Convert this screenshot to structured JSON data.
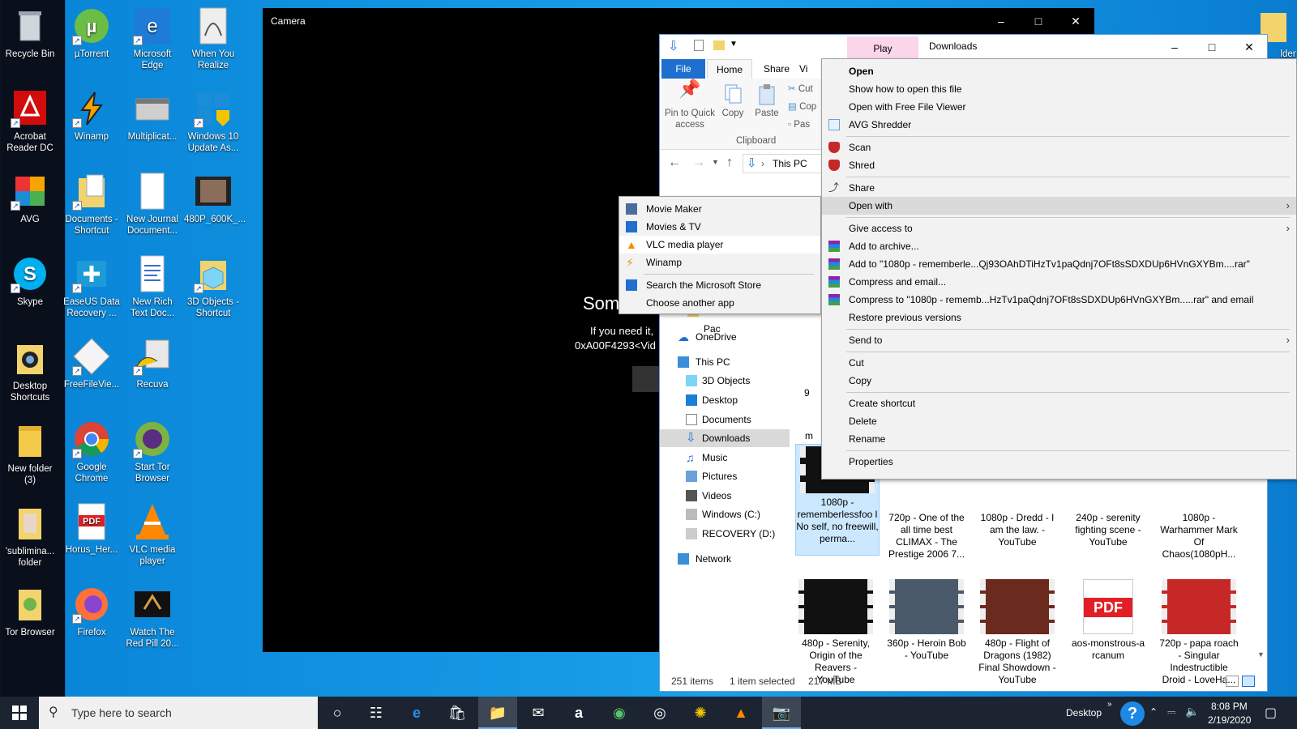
{
  "desktop": {
    "col1": [
      "Recycle Bin",
      "Acrobat Reader DC",
      "AVG",
      "Skype",
      "Desktop Shortcuts",
      "New folder (3)",
      "'sublimina... folder",
      "Tor Browser"
    ],
    "col2": [
      "µTorrent",
      "Winamp",
      "Documents - Shortcut",
      "EaseUS Data Recovery ...",
      "FreeFileVie...",
      "Google Chrome",
      "Horus_Her...",
      "Firefox"
    ],
    "col3": [
      "Microsoft Edge",
      "Multiplicat...",
      "New Journal Document...",
      "New Rich Text Doc...",
      "Recuva",
      "Start Tor Browser",
      "VLC media player",
      "Watch The Red Pill 20..."
    ],
    "col4": [
      "When You Realize",
      "Windows 10 Update As...",
      "480P_600K_...",
      "3D Objects - Shortcut"
    ],
    "right_edge": "lder"
  },
  "camera": {
    "title": "Camera",
    "message_heading": "Som",
    "message_line1": "If you need it,",
    "message_line2": "0xA00F4293<Vid"
  },
  "explorer": {
    "context_tab": "Play",
    "window_title": "Downloads",
    "tabs": [
      "File",
      "Home",
      "Share",
      "Vi"
    ],
    "clipboard": {
      "pin": "Pin to Quick access",
      "copy": "Copy",
      "paste": "Paste",
      "cut": "Cut",
      "copy_path": "Cop",
      "paste_shortcut": "Pas",
      "group_label": "Clipboard"
    },
    "address": "This PC",
    "nav": [
      "Kimber Lee - VR Pac",
      "OneDrive",
      "This PC",
      "3D Objects",
      "Desktop",
      "Documents",
      "Downloads",
      "Music",
      "Pictures",
      "Videos",
      "Windows (C:)",
      "RECOVERY (D:)",
      "Network"
    ],
    "files_row1": [
      "1080p - rememberlessfoo l No self, no freewill, perma...",
      "720p - One of the all time best CLIMAX - The Prestige 2006 7...",
      "1080p - Dredd - I am the law. - YouTube",
      "240p - serenity fighting scene - YouTube",
      "1080p - Warhammer Mark Of Chaos(1080pH..."
    ],
    "files_row2": [
      "480p - Serenity, Origin of the Reavers - YouTube",
      "360p - Heroin Bob - YouTube",
      "480p - Flight of Dragons (1982) Final Showdown - YouTube",
      "aos-monstrous-a rcanum",
      "720p - papa roach - Singular Indestructible Droid - LoveHa..."
    ],
    "partial_labels": [
      "9",
      "m"
    ],
    "status_items": "251 items",
    "status_selected": "1 item selected",
    "status_size": "217 MB"
  },
  "context_menu": {
    "open": "Open",
    "show_how": "Show how to open this file",
    "open_free": "Open with Free File Viewer",
    "avg_shredder": "AVG Shredder",
    "scan": "Scan",
    "shred": "Shred",
    "share": "Share",
    "open_with": "Open with",
    "give_access": "Give access to",
    "add_archive": "Add to archive...",
    "add_to_rar": "Add to \"1080p - rememberle...Qj93OAhDTiHzTv1paQdnj7OFt8sSDXDUp6HVnGXYBm....rar\"",
    "compress_email": "Compress and email...",
    "compress_to_rar": "Compress to \"1080p - rememb...HzTv1paQdnj7OFt8sSDXDUp6HVnGXYBm.....rar\" and email",
    "restore": "Restore previous versions",
    "send_to": "Send to",
    "cut": "Cut",
    "copy": "Copy",
    "create_shortcut": "Create shortcut",
    "delete": "Delete",
    "rename": "Rename",
    "properties": "Properties"
  },
  "open_with_menu": {
    "movie_maker": "Movie Maker",
    "movies_tv": "Movies & TV",
    "vlc": "VLC media player",
    "winamp": "Winamp",
    "search_store": "Search the Microsoft Store",
    "choose_another": "Choose another app"
  },
  "taskbar": {
    "search_placeholder": "Type here to search",
    "desktop_label": "Desktop",
    "time": "8:08 PM",
    "date": "2/19/2020"
  }
}
